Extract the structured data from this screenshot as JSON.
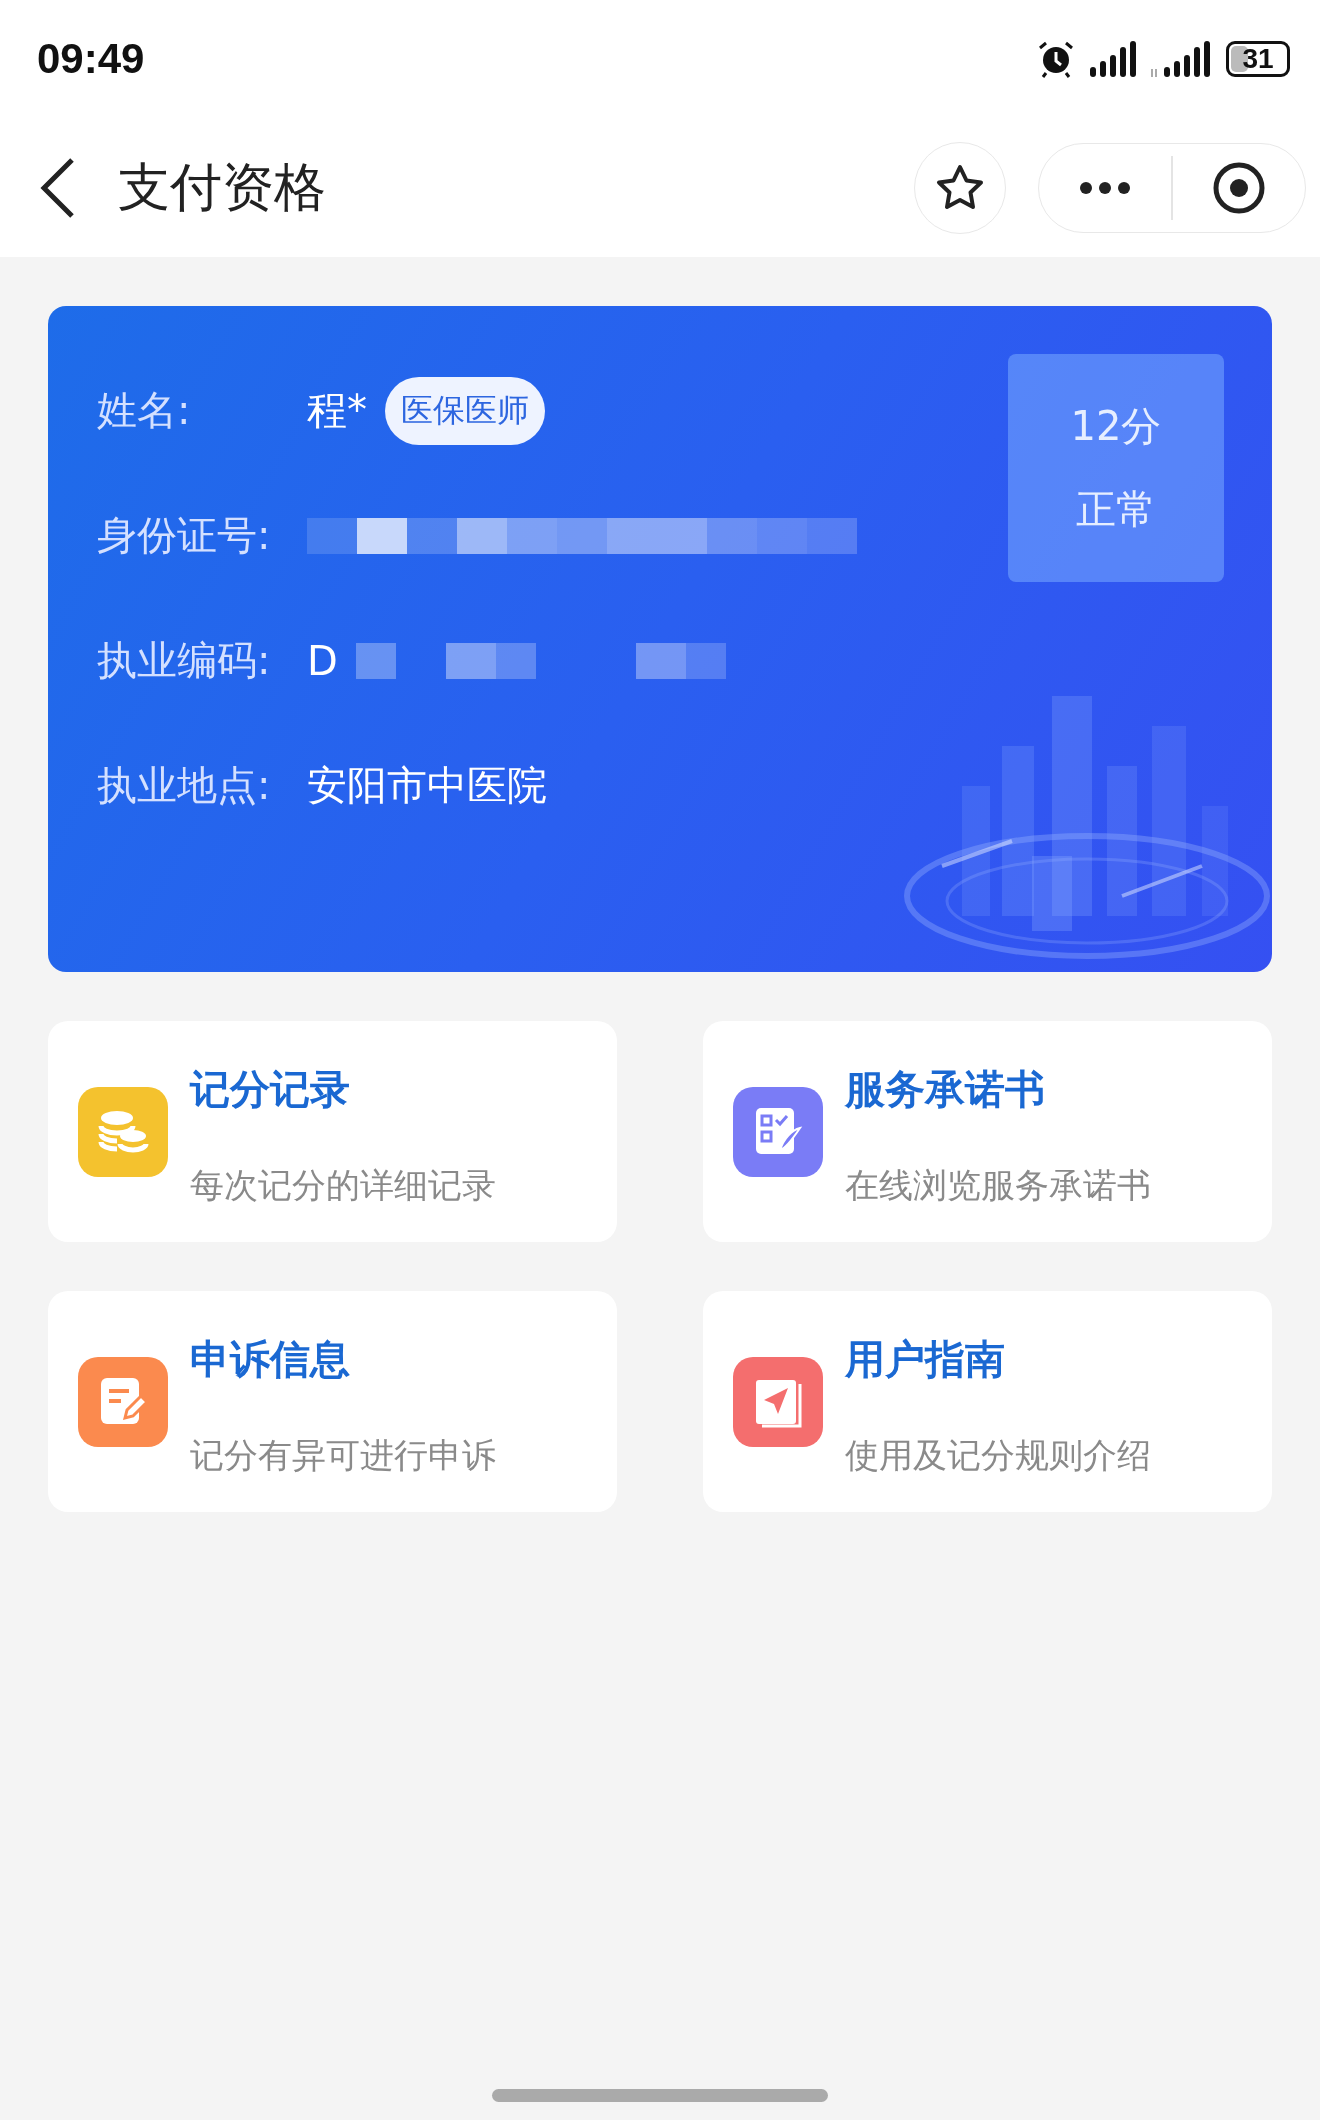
{
  "status_bar": {
    "time": "09:49",
    "battery": "31"
  },
  "nav": {
    "title": "支付资格"
  },
  "card": {
    "fields": [
      {
        "label": "姓名:",
        "value": "程*",
        "badge": "医保医师"
      },
      {
        "label": "身份证号:",
        "masked": true
      },
      {
        "label": "执业编码:",
        "value": "D",
        "masked": true
      },
      {
        "label": "执业地点:",
        "value": "安阳市中医院"
      }
    ],
    "score": "12分",
    "status": "正常"
  },
  "tiles": [
    {
      "title": "记分记录",
      "subtitle": "每次记分的详细记录",
      "kind": "coins",
      "color": "#f4c22e"
    },
    {
      "title": "服务承诺书",
      "subtitle": "在线浏览服务承诺书",
      "kind": "checklist",
      "color": "#7a7cf6"
    },
    {
      "title": "申诉信息",
      "subtitle": "记分有异可进行申诉",
      "kind": "edit",
      "color": "#fb8a4e"
    },
    {
      "title": "用户指南",
      "subtitle": "使用及记分规则介绍",
      "kind": "guide",
      "color": "#f46e6e"
    }
  ]
}
